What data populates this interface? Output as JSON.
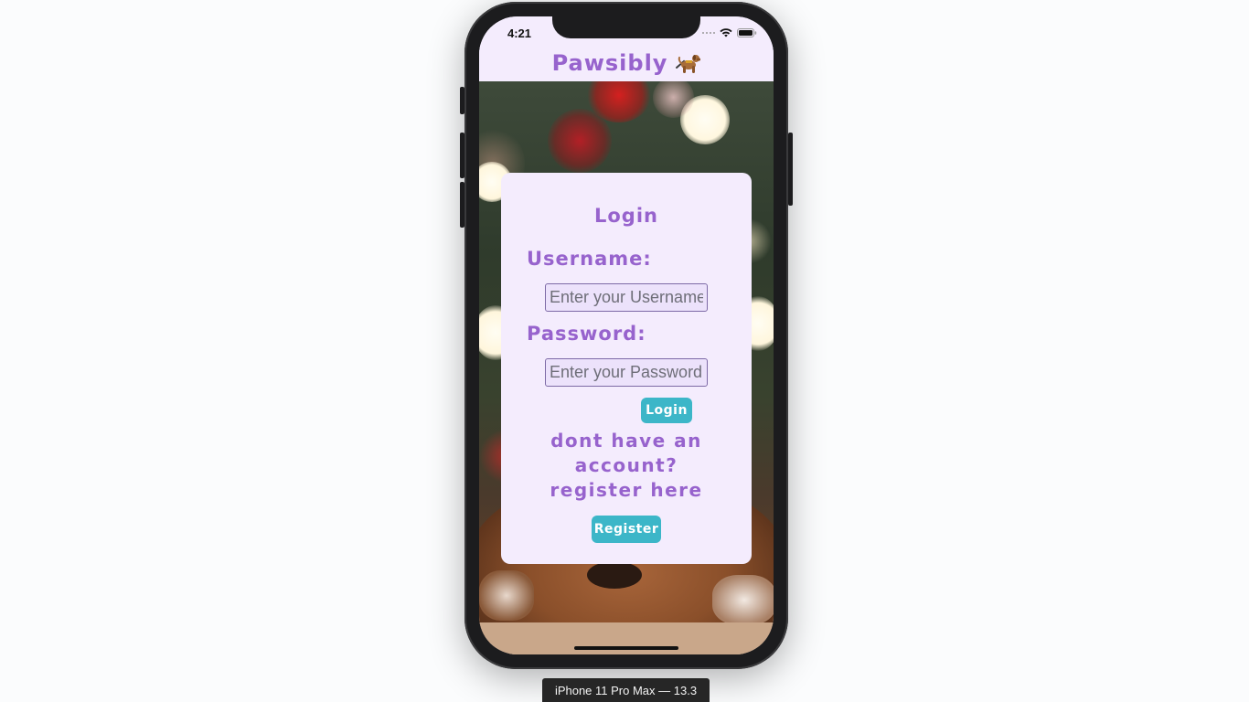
{
  "status_bar": {
    "time": "4:21"
  },
  "app": {
    "title": "Pawsibly",
    "title_icon": "guide-dog-icon",
    "accent_color": "#9763cd",
    "button_color": "#3cb6c8",
    "card_color": "#f4ecfd"
  },
  "login_form": {
    "title": "Login",
    "username_label": "Username:",
    "username_placeholder": "Enter your Username",
    "username_value": "",
    "password_label": "Password:",
    "password_placeholder": "Enter your Password",
    "password_value": "",
    "login_button": "Login",
    "register_prompt": "dont have an account? register here",
    "register_button": "Register"
  },
  "simulator": {
    "device_label": "iPhone 11 Pro Max — 13.3"
  }
}
